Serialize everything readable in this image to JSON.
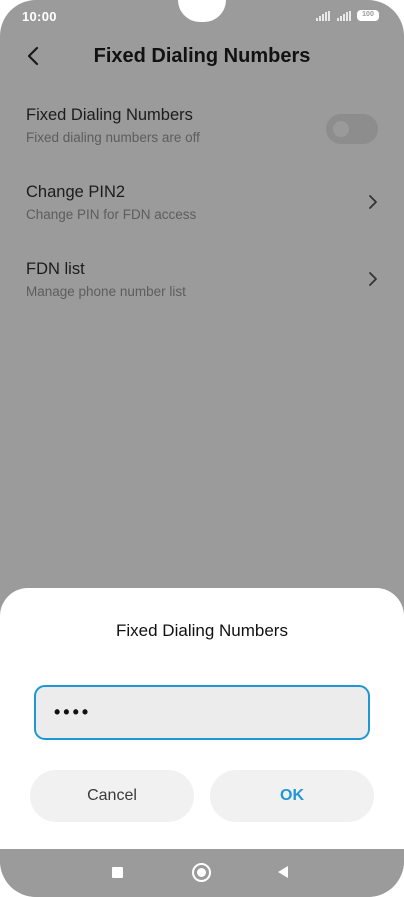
{
  "status_bar": {
    "time": "10:00",
    "battery": "100"
  },
  "header": {
    "title": "Fixed Dialing Numbers"
  },
  "settings": {
    "items": [
      {
        "title": "Fixed Dialing Numbers",
        "subtitle": "Fixed dialing numbers are off",
        "control": "toggle",
        "enabled": false
      },
      {
        "title": "Change PIN2",
        "subtitle": "Change PIN for FDN access",
        "control": "chevron"
      },
      {
        "title": "FDN list",
        "subtitle": "Manage phone number list",
        "control": "chevron"
      }
    ]
  },
  "dialog": {
    "title": "Fixed Dialing Numbers",
    "input_value": "••••",
    "cancel_label": "Cancel",
    "ok_label": "OK"
  },
  "colors": {
    "accent": "#1f97d5",
    "dim_overlay": "#9b9b9b"
  },
  "icons": {
    "back": "back-arrow-icon",
    "chevron": "chevron-right-icon",
    "nav_recents": "square-icon",
    "nav_home": "home-circle-icon",
    "nav_back": "triangle-back-icon"
  }
}
